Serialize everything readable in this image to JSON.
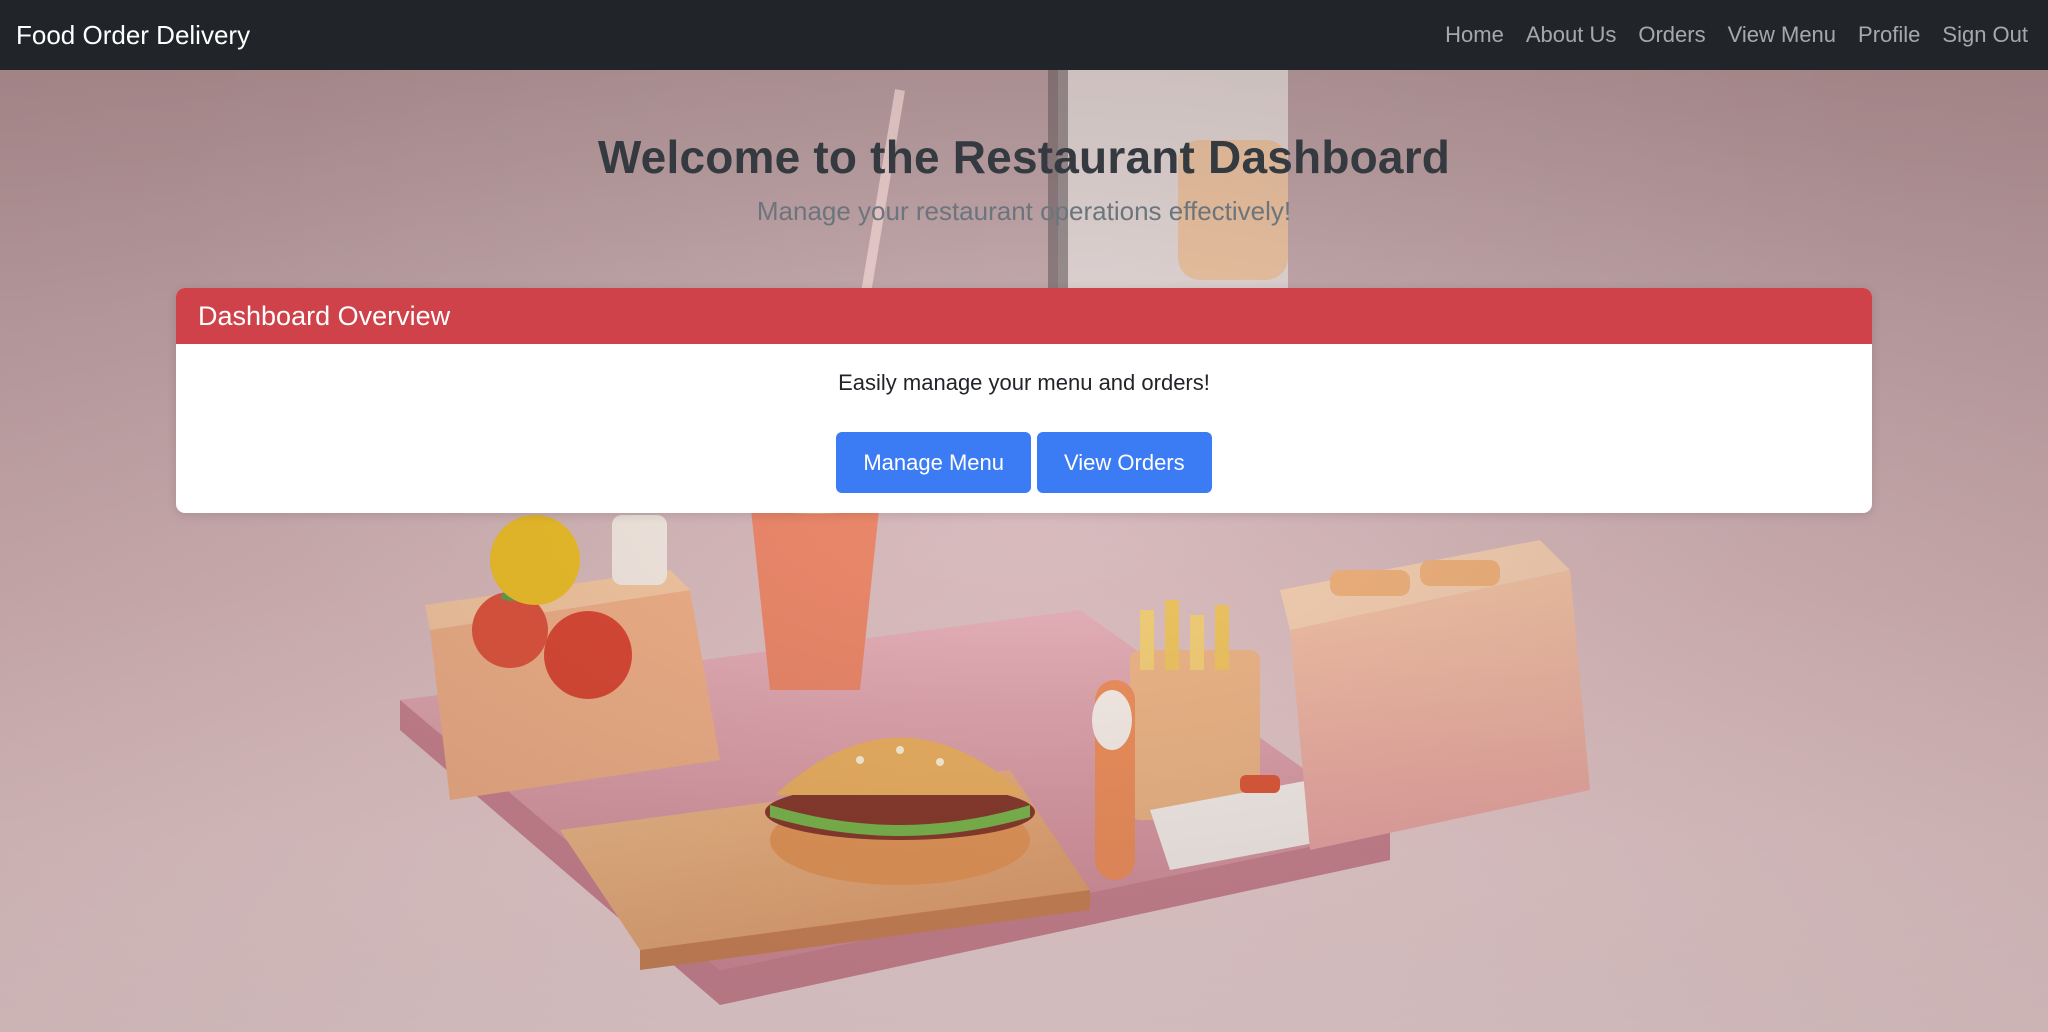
{
  "navbar": {
    "brand": "Food Order Delivery",
    "links": [
      "Home",
      "About Us",
      "Orders",
      "View Menu",
      "Profile",
      "Sign Out"
    ]
  },
  "hero": {
    "title": "Welcome to the Restaurant Dashboard",
    "subtitle": "Manage your restaurant operations effectively!"
  },
  "card": {
    "header": "Dashboard Overview",
    "text": "Easily manage your menu and orders!",
    "buttons": {
      "manage_menu": "Manage Menu",
      "view_orders": "View Orders"
    }
  },
  "colors": {
    "navbar_bg": "#212529",
    "card_header": "#cf424a",
    "primary_button": "#3b7cf4",
    "background": "#e7c9c9"
  }
}
